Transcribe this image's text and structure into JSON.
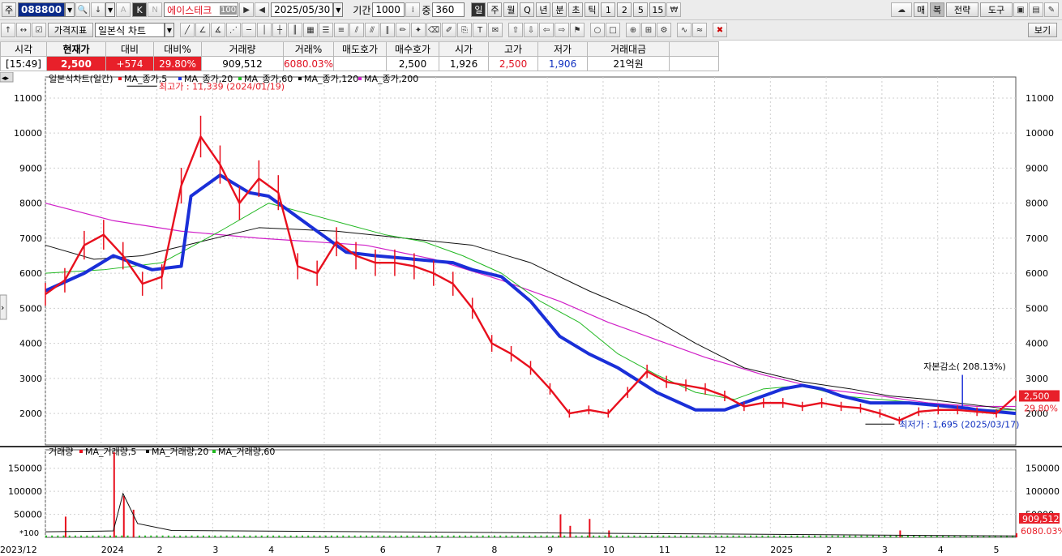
{
  "toolbar1": {
    "market": "주",
    "stock_code": "088800",
    "stock_name": "에이스테크",
    "name_badge": "100",
    "date": "2025/05/30",
    "period_label": "기간",
    "period_value": "1000",
    "view_label": "중",
    "view_value": "360",
    "intervals": [
      "일",
      "주",
      "월",
      "Q",
      "년",
      "분",
      "초",
      "틱",
      "1",
      "2",
      "5",
      "15"
    ],
    "right_buttons": [
      "매",
      "복",
      "전략",
      "도구"
    ]
  },
  "toolbar2": {
    "price_indicator": "가격지표",
    "chart_type": "일본식 차트",
    "view_button": "보기"
  },
  "quote": {
    "headers": [
      "시각",
      "현재가",
      "대비",
      "대비%",
      "거래량",
      "거래%",
      "매도호가",
      "매수호가",
      "시가",
      "고가",
      "저가",
      "거래대금"
    ],
    "values": [
      "[15:49]",
      "2,500",
      "+574",
      "29.80%",
      "909,512",
      "6080.03%",
      "",
      "2,500",
      "1,926",
      "2,500",
      "1,906",
      "21억원"
    ]
  },
  "colors": {
    "candle": "#e8101e",
    "ma5": "#e8101e",
    "ma20": "#1a2fd8",
    "ma60": "#22b822",
    "ma120": "#111111",
    "ma200": "#d020c8",
    "accent_red": "#e8202a"
  },
  "chart_data": [
    {
      "type": "line",
      "title": "일본식차트(일간)",
      "legend": [
        "MA_종가,5",
        "MA_종가,20",
        "MA_종가,60",
        "MA_종가,120",
        "MA_종가,200"
      ],
      "ylim": [
        1100,
        11600
      ],
      "yticks": [
        2000,
        3000,
        4000,
        5000,
        6000,
        7000,
        8000,
        9000,
        10000,
        11000
      ],
      "x_labels": [
        "2023/12",
        "2024",
        "2",
        "3",
        "4",
        "5",
        "6",
        "7",
        "8",
        "9",
        "10",
        "11",
        "12",
        "2025",
        "2",
        "3",
        "4",
        "5"
      ],
      "series": [
        {
          "name": "MA_종가,5",
          "values": [
            5400,
            5800,
            6800,
            7100,
            6500,
            5700,
            5900,
            8500,
            9900,
            9100,
            8000,
            8700,
            8300,
            6200,
            6000,
            6900,
            6500,
            6300,
            6300,
            6200,
            6000,
            5700,
            5000,
            4000,
            3700,
            3300,
            2700,
            2000,
            2100,
            2000,
            2600,
            3200,
            2900,
            2800,
            2700,
            2500,
            2200,
            2300,
            2300,
            2200,
            2300,
            2200,
            2150,
            2000,
            1800,
            2050,
            2100,
            2100,
            2050,
            2000,
            2500
          ],
          "note_x": [
            0,
            2,
            4,
            6,
            8,
            10,
            12,
            14,
            16,
            18,
            20,
            22,
            24,
            26,
            28,
            30,
            32,
            34,
            36,
            38,
            40,
            42,
            44,
            46,
            48,
            50,
            52,
            54,
            56,
            58,
            60,
            62,
            64,
            66,
            68,
            70,
            72,
            74,
            76,
            78,
            80,
            82,
            84,
            86,
            88,
            90,
            92,
            94,
            96,
            98,
            100
          ]
        },
        {
          "name": "MA_종가,20",
          "values": [
            5500,
            6000,
            6500,
            6100,
            6200,
            8200,
            8800,
            8300,
            8200,
            7800,
            7200,
            6600,
            6500,
            6400,
            6300,
            6100,
            5900,
            5200,
            4200,
            3700,
            3300,
            2600,
            2100,
            2100,
            2400,
            2700,
            2800,
            2700,
            2500,
            2300,
            2300,
            2300,
            2250,
            2200,
            2150,
            2100,
            2050,
            2000
          ],
          "note_x": [
            0,
            4,
            7,
            11,
            14,
            15,
            18,
            21,
            23,
            25,
            28,
            31,
            34,
            38,
            42,
            44,
            47,
            50,
            53,
            56,
            59,
            63,
            67,
            70,
            73,
            76,
            78,
            80,
            82,
            85,
            87,
            89,
            91,
            93,
            95,
            96,
            98,
            100
          ]
        },
        {
          "name": "MA_종가,60",
          "values": [
            6000,
            6100,
            6300,
            7200,
            8000,
            7700,
            7400,
            7100,
            6900,
            6500,
            6000,
            5200,
            4600,
            3700,
            3100,
            2600,
            2400,
            2700,
            2800,
            2500,
            2400,
            2300,
            2200,
            2100,
            2100
          ],
          "note_x": [
            0,
            6,
            12,
            18,
            23,
            27,
            31,
            35,
            39,
            43,
            47,
            51,
            55,
            59,
            63,
            67,
            71,
            74,
            78,
            82,
            86,
            90,
            94,
            97,
            100
          ]
        },
        {
          "name": "MA_종가,120",
          "values": [
            6800,
            6400,
            6500,
            6900,
            7300,
            7200,
            7000,
            6800,
            6300,
            5500,
            4800,
            4000,
            3300,
            2900,
            2700,
            2500,
            2400,
            2300,
            2200,
            2100
          ],
          "note_x": [
            0,
            5,
            10,
            16,
            22,
            30,
            37,
            44,
            50,
            56,
            62,
            67,
            72,
            78,
            83,
            87,
            91,
            94,
            97,
            100
          ]
        },
        {
          "name": "MA_종가,200",
          "values": [
            8000,
            7500,
            7200,
            7000,
            6800,
            6400,
            5800,
            5200,
            4600,
            4100,
            3600,
            3100,
            2700,
            2500,
            2300,
            2200,
            2200
          ],
          "note_x": [
            0,
            7,
            14,
            22,
            33,
            40,
            47,
            53,
            58,
            63,
            68,
            74,
            80,
            86,
            91,
            96,
            100
          ]
        }
      ],
      "annotations": [
        {
          "label": "최고가 : 11,339 (2024/01/19)",
          "value": 11339
        },
        {
          "label": "최저가 : 1,695 (2025/03/17)",
          "value": 1695
        },
        {
          "label": "자본감소( 208.13%)",
          "value": 2200
        }
      ],
      "right_labels": [
        {
          "label": "2,500",
          "value": 2500
        },
        {
          "label": "29.80%",
          "value": 2150
        }
      ]
    },
    {
      "type": "bar",
      "title": "거래량",
      "legend": [
        "MA_거래량,5",
        "MA_거래량,20",
        "MA_거래량,60"
      ],
      "ylim": [
        0,
        190000
      ],
      "yticks": [
        50000,
        100000,
        150000
      ],
      "scale_label": "*100",
      "spikes": [
        {
          "x": 2,
          "value": 45000
        },
        {
          "x": 7,
          "value": 185000
        },
        {
          "x": 8,
          "value": 90000
        },
        {
          "x": 9,
          "value": 60000
        },
        {
          "x": 53,
          "value": 50000
        },
        {
          "x": 54,
          "value": 25000
        },
        {
          "x": 56,
          "value": 40000
        },
        {
          "x": 58,
          "value": 15000
        },
        {
          "x": 88,
          "value": 15000
        },
        {
          "x": 100,
          "value": 9000
        }
      ],
      "right_labels": [
        {
          "label": "909,512",
          "value": 30000
        },
        {
          "label": "6080.03%",
          "value": 7000
        }
      ]
    }
  ]
}
